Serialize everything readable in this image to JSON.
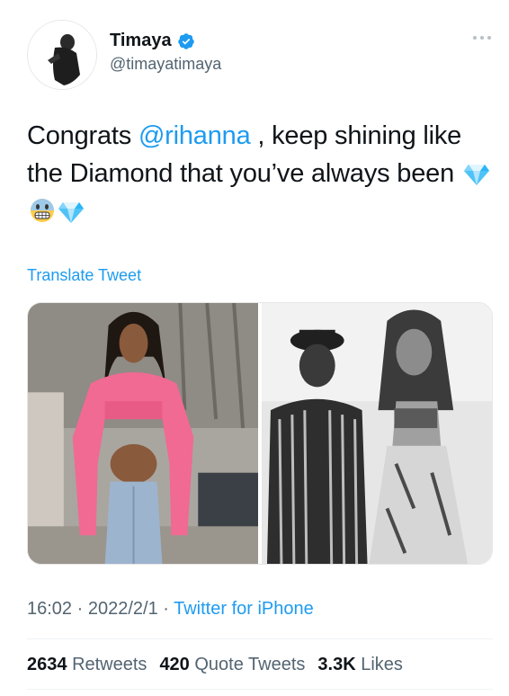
{
  "user": {
    "display_name": "Timaya",
    "handle": "@timayatimaya",
    "verified": true
  },
  "tweet": {
    "text_part1": "Congrats ",
    "mention": "@rihanna",
    "text_part2": " , keep shining like the Diamond that you’ve always been",
    "emojis": [
      "gem-icon",
      "grimacing-face-icon",
      "gem-icon"
    ]
  },
  "translate_label": "Translate Tweet",
  "media": {
    "images": [
      {
        "name": "photo-woman-pink-jacket"
      },
      {
        "name": "photo-two-people-black-white"
      }
    ]
  },
  "meta": {
    "time": "16:02",
    "separator": " · ",
    "date": "2022/2/1",
    "source": "Twitter for iPhone"
  },
  "stats": {
    "retweets_count": "2634",
    "retweets_label": "Retweets",
    "quotes_count": "420",
    "quotes_label": "Quote Tweets",
    "likes_count": "3.3K",
    "likes_label": "Likes"
  },
  "colors": {
    "accent": "#1d9bf0",
    "text": "#0f1419",
    "secondary": "#536471",
    "pink_jacket": "#f06a93"
  }
}
